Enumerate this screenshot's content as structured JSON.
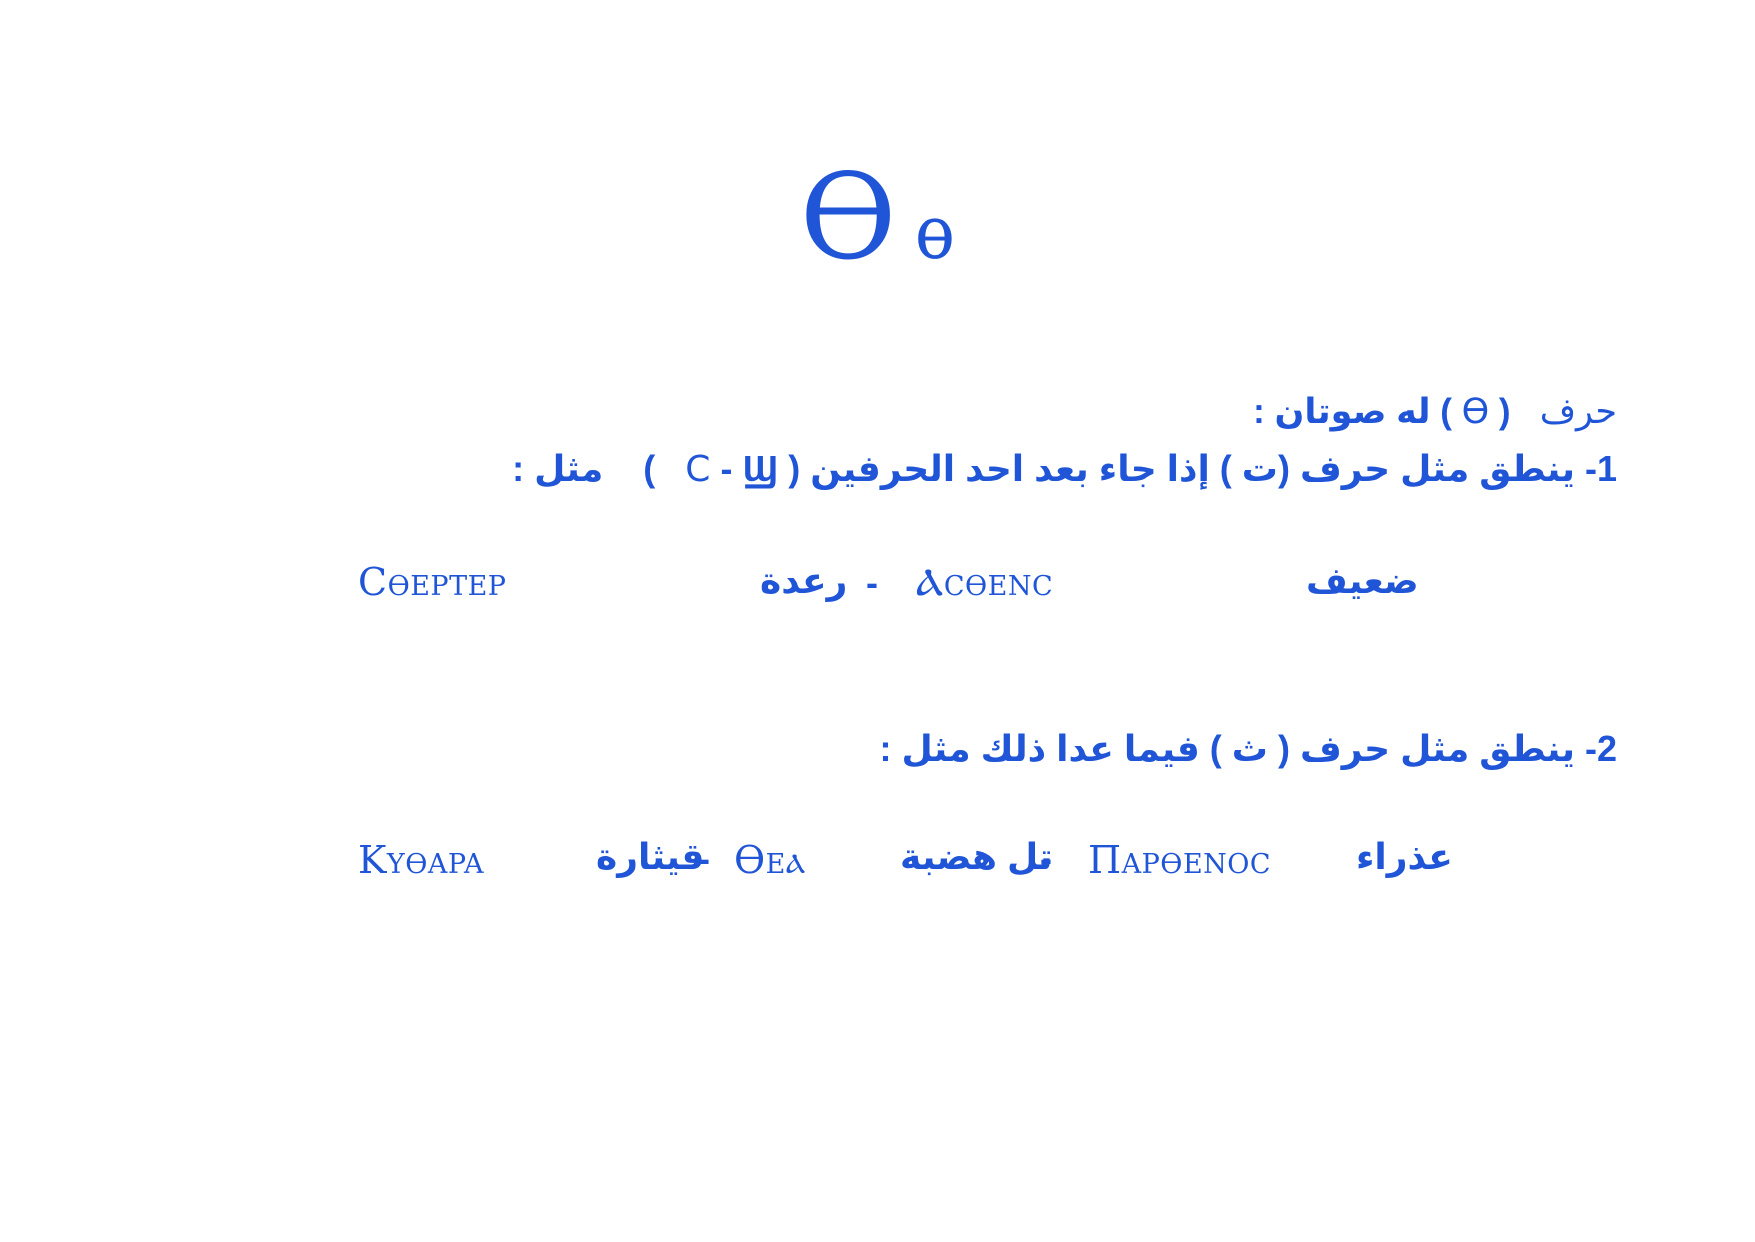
{
  "heading": {
    "upper": "Ѳ",
    "lower": "ѳ"
  },
  "intro": {
    "prefix": "حرف",
    "open": "(",
    "letter": "Ѳ",
    "close": ")",
    "suffix": "له صوتان :"
  },
  "rule1": {
    "text_a": "1- ينطق مثل حرف (ت ) إذا جاء بعد احد الحرفين",
    "open": "(",
    "shai": "Ϣ",
    "sep": "-",
    "sima": "C",
    "close": ")",
    "text_b": "مثل :"
  },
  "examples1": {
    "item1_coptic": "Cѳeptep",
    "item1_arabic": "رعدة",
    "dash": "-",
    "item2_coptic": "Ⲁcѳenc",
    "item2_arabic": "ضعيف"
  },
  "rule2": {
    "text": "2- ينطق مثل حرف ( ث ) فيما عدا ذلك   مثل :"
  },
  "examples2": {
    "item1_coptic": "Kyѳapa",
    "item1_arabic": "قيثارة",
    "dash1": "-",
    "item2_coptic": "Ѳeⲁ",
    "item2_arabic": "تل هضبة",
    "dash2": "-",
    "item3_coptic": "Πapѳenoc",
    "item3_arabic": "عذراء"
  }
}
